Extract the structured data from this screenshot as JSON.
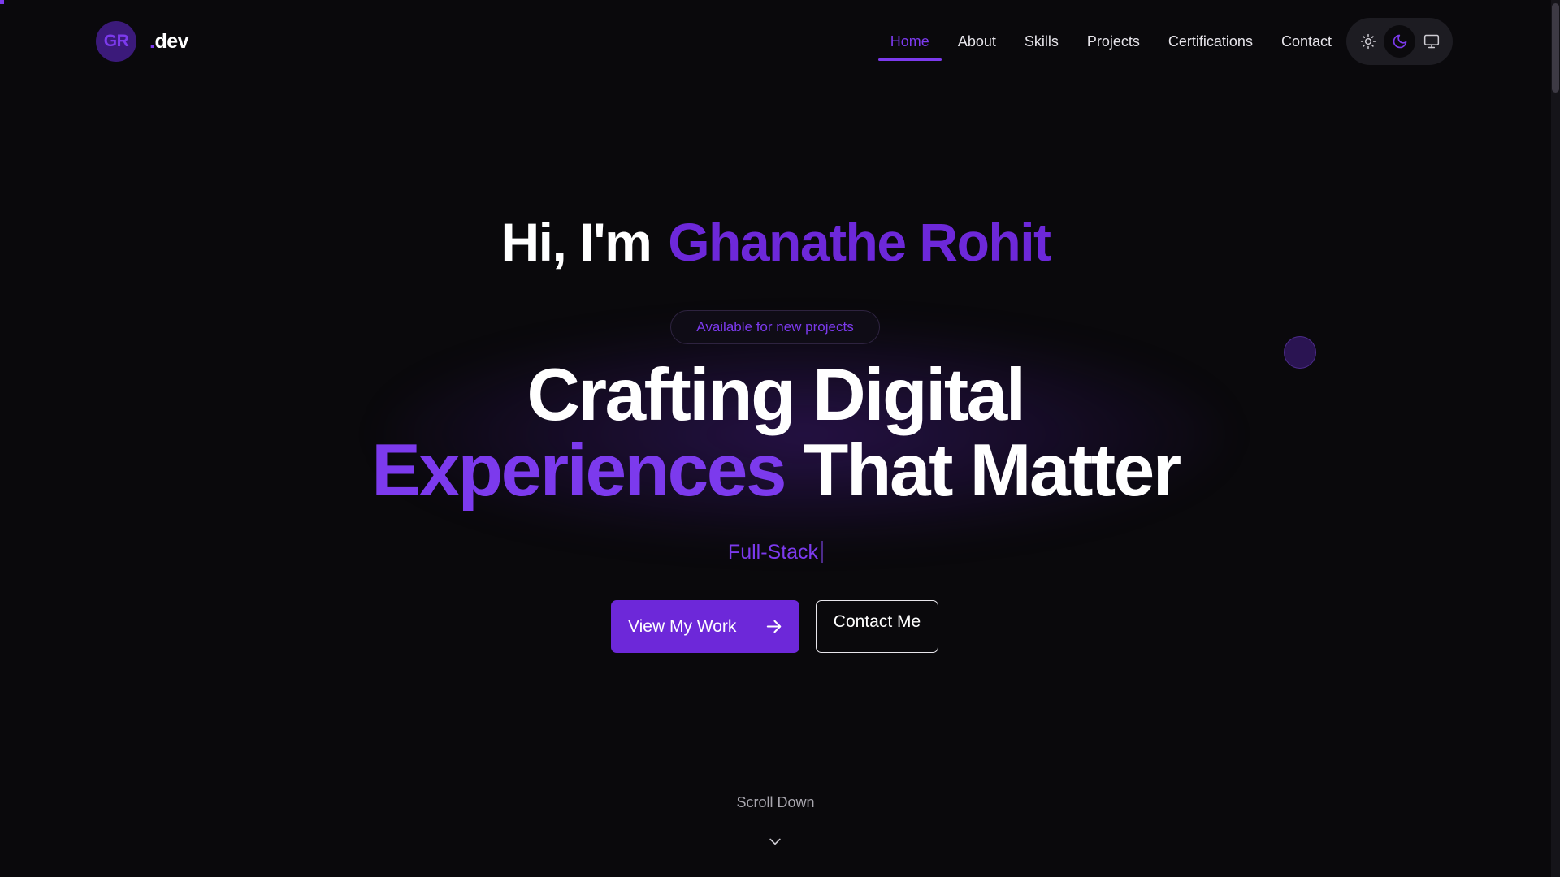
{
  "logo": {
    "initials": "GR",
    "dot": ".",
    "suffix": "dev"
  },
  "nav": {
    "items": [
      {
        "label": "Home",
        "active": true
      },
      {
        "label": "About",
        "active": false
      },
      {
        "label": "Skills",
        "active": false
      },
      {
        "label": "Projects",
        "active": false
      },
      {
        "label": "Certifications",
        "active": false
      },
      {
        "label": "Contact",
        "active": false
      }
    ]
  },
  "theme_switch": {
    "options": [
      "sun-icon",
      "moon-icon",
      "monitor-icon"
    ],
    "selected": "moon-icon"
  },
  "hero": {
    "greeting_prefix": "Hi, I'm",
    "name": "Ghanathe Rohit",
    "badge": "Available for new projects",
    "headline_line1": "Crafting Digital",
    "headline_accent": "Experiences",
    "headline_rest": "That Matter",
    "typed_role": "Full-Stack",
    "primary_cta": "View My Work",
    "secondary_cta": "Contact Me",
    "scroll_hint": "Scroll Down"
  },
  "colors": {
    "background": "#0a090c",
    "accent": "#7c3aed",
    "accent_dark": "#6d28d9",
    "text": "#ffffff",
    "muted": "#a8a6ae"
  }
}
